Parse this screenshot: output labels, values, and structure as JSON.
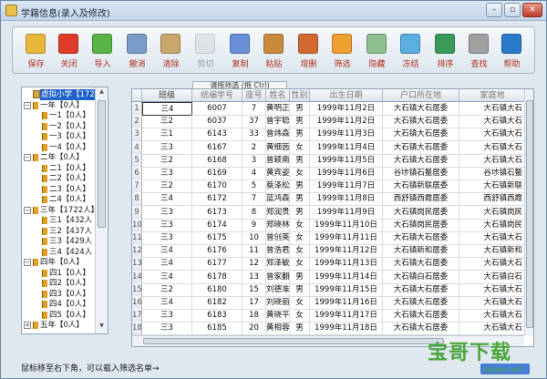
{
  "window": {
    "title": "学籍信息(录入及修改)"
  },
  "toolbar": [
    {
      "label": "保存",
      "icon": "save-icon",
      "color": "#e8b73a",
      "enabled": true
    },
    {
      "label": "关闭",
      "icon": "close-x-icon",
      "color": "#e03a2a",
      "enabled": true
    },
    {
      "label": "导入",
      "icon": "import-arrow-icon",
      "color": "#59b347",
      "enabled": true
    },
    {
      "label": "撤消",
      "icon": "undo-icon",
      "color": "#7a9cc9",
      "enabled": true
    },
    {
      "label": "清除",
      "icon": "eraser-icon",
      "color": "#c9a66b",
      "enabled": true
    },
    {
      "label": "剪切",
      "icon": "scissors-icon",
      "color": "#d0d0d0",
      "enabled": false
    },
    {
      "label": "复制",
      "icon": "copy-icon",
      "color": "#6b8fd6",
      "enabled": true
    },
    {
      "label": "粘贴",
      "icon": "paste-icon",
      "color": "#c98a3a",
      "enabled": true
    },
    {
      "label": "增删",
      "icon": "add-remove-users-icon",
      "color": "#d06a30",
      "enabled": true
    },
    {
      "label": "筛选",
      "icon": "filter-funnel-icon",
      "color": "#f0a030",
      "enabled": true
    },
    {
      "label": "隐藏",
      "icon": "hide-grid-icon",
      "color": "#8fbf8f",
      "enabled": true
    },
    {
      "label": "冻结",
      "icon": "snowflake-icon",
      "color": "#5aaee0",
      "enabled": true
    },
    {
      "label": "排序",
      "icon": "sort-bars-icon",
      "color": "#3a9a5a",
      "enabled": true
    },
    {
      "label": "查找",
      "icon": "magnifier-icon",
      "color": "#a0a0a0",
      "enabled": true
    },
    {
      "label": "帮助",
      "icon": "help-question-icon",
      "color": "#2a7ac9",
      "enabled": true
    }
  ],
  "tree": [
    {
      "text": "虚拟小学【1722人",
      "level": 0,
      "expander": "",
      "type": "root",
      "selected": true
    },
    {
      "text": "一年【0人】",
      "level": 1,
      "expander": "−",
      "type": "grade"
    },
    {
      "text": "一1【0人】",
      "level": 2,
      "expander": "",
      "type": "class"
    },
    {
      "text": "一2【0人】",
      "level": 2,
      "expander": "",
      "type": "class"
    },
    {
      "text": "一3【0人】",
      "level": 2,
      "expander": "",
      "type": "class"
    },
    {
      "text": "一4【0人】",
      "level": 2,
      "expander": "",
      "type": "class"
    },
    {
      "text": "二年【0人】",
      "level": 1,
      "expander": "−",
      "type": "grade"
    },
    {
      "text": "二1【0人】",
      "level": 2,
      "expander": "",
      "type": "class"
    },
    {
      "text": "二2【0人】",
      "level": 2,
      "expander": "",
      "type": "class"
    },
    {
      "text": "二3【0人】",
      "level": 2,
      "expander": "",
      "type": "class"
    },
    {
      "text": "二4【0人】",
      "level": 2,
      "expander": "",
      "type": "class"
    },
    {
      "text": "三年【1722人】",
      "level": 1,
      "expander": "−",
      "type": "grade"
    },
    {
      "text": "三1【432人",
      "level": 2,
      "expander": "",
      "type": "class"
    },
    {
      "text": "三2【437人",
      "level": 2,
      "expander": "",
      "type": "class"
    },
    {
      "text": "三3【429人",
      "level": 2,
      "expander": "",
      "type": "class"
    },
    {
      "text": "三4【424人",
      "level": 2,
      "expander": "",
      "type": "class"
    },
    {
      "text": "四年【0人】",
      "level": 1,
      "expander": "−",
      "type": "grade"
    },
    {
      "text": "四1【0人】",
      "level": 2,
      "expander": "",
      "type": "class"
    },
    {
      "text": "四2【0人】",
      "level": 2,
      "expander": "",
      "type": "class"
    },
    {
      "text": "四3【0人】",
      "level": 2,
      "expander": "",
      "type": "class"
    },
    {
      "text": "四4【0人】",
      "level": 2,
      "expander": "",
      "type": "class"
    },
    {
      "text": "四5【0人】",
      "level": 2,
      "expander": "",
      "type": "class"
    },
    {
      "text": "五年【0人】",
      "level": 1,
      "expander": "+",
      "type": "grade"
    }
  ],
  "tab_hint": "请拖筛选 (拖 Ctrl)",
  "grid": {
    "columns": [
      "",
      "班级",
      "统编学号",
      "座号",
      "姓名",
      "性别",
      "出生日期",
      "户口所在地",
      "家庭地"
    ],
    "rows": [
      [
        "1",
        "三4",
        "6007",
        "7",
        "黄明正",
        "男",
        "1999年11月2日",
        "大石镇大石居委",
        "大石镇大石"
      ],
      [
        "2",
        "三2",
        "6037",
        "37",
        "曾宇聪",
        "男",
        "1999年11月2日",
        "大石镇大石居委",
        "大石镇大石"
      ],
      [
        "3",
        "三1",
        "6143",
        "33",
        "曾炜森",
        "男",
        "1999年11月3日",
        "大石镇大石居委",
        "大石镇大石"
      ],
      [
        "4",
        "三3",
        "6167",
        "2",
        "黄细茵",
        "女",
        "1999年11月4日",
        "大石镇大石居委",
        "大石镇大石"
      ],
      [
        "5",
        "三2",
        "6168",
        "3",
        "曾颖南",
        "男",
        "1999年11月5日",
        "大石镇大石居委",
        "大石镇大石"
      ],
      [
        "6",
        "三3",
        "6169",
        "4",
        "黄宾姿",
        "女",
        "1999年11月6日",
        "谷埗镇石鳌居委",
        "谷埗镇石鳌"
      ],
      [
        "7",
        "三2",
        "6170",
        "5",
        "蔡泽松",
        "男",
        "1999年11月7日",
        "大石镇新联居委",
        "大石镇新联"
      ],
      [
        "8",
        "三4",
        "6172",
        "7",
        "蓝鸿森",
        "男",
        "1999年11月8日",
        "西舒镇西霞居委",
        "西舒镇西霞"
      ],
      [
        "9",
        "三3",
        "6173",
        "8",
        "郑润贵",
        "男",
        "1999年11月9日",
        "大石镇岗民居委",
        "大石镇岗民"
      ],
      [
        "10",
        "三3",
        "6174",
        "9",
        "郑晓林",
        "女",
        "1999年11月10日",
        "大石镇岗民居委",
        "大石镇岗民"
      ],
      [
        "11",
        "三3",
        "6175",
        "10",
        "曾创英",
        "女",
        "1999年11月11日",
        "大石镇大石居委",
        "大石镇大石"
      ],
      [
        "12",
        "三4",
        "6176",
        "11",
        "曾浩君",
        "女",
        "1999年11月12日",
        "大石镇新和居委",
        "大石镇新和"
      ],
      [
        "13",
        "三4",
        "6177",
        "12",
        "郑泽敏",
        "女",
        "1999年11月13日",
        "大石镇大石居委",
        "大石镇大石"
      ],
      [
        "14",
        "三4",
        "6178",
        "13",
        "曾家翻",
        "男",
        "1999年11月14日",
        "大石镇白石居委",
        "大石镇白石"
      ],
      [
        "15",
        "三2",
        "6180",
        "15",
        "刘德准",
        "男",
        "1999年11月15日",
        "大石镇大石居委",
        "大石镇大石"
      ],
      [
        "16",
        "三4",
        "6182",
        "17",
        "刘晓丽",
        "女",
        "1999年11月16日",
        "大石镇大石居委",
        "大石镇大石"
      ],
      [
        "17",
        "三3",
        "6183",
        "18",
        "黄晓平",
        "女",
        "1999年11月17日",
        "大石镇大石居委",
        "大石镇大石"
      ],
      [
        "18",
        "三3",
        "6185",
        "20",
        "黄相蓉",
        "男",
        "1999年11月18日",
        "大石镇大石居委",
        "大石镇大石"
      ]
    ]
  },
  "status": {
    "text": "鼠标移至右下角，可以载入筛选名单→"
  },
  "watermark": {
    "main": "宝哥下载",
    "sub": "paoge.net"
  }
}
